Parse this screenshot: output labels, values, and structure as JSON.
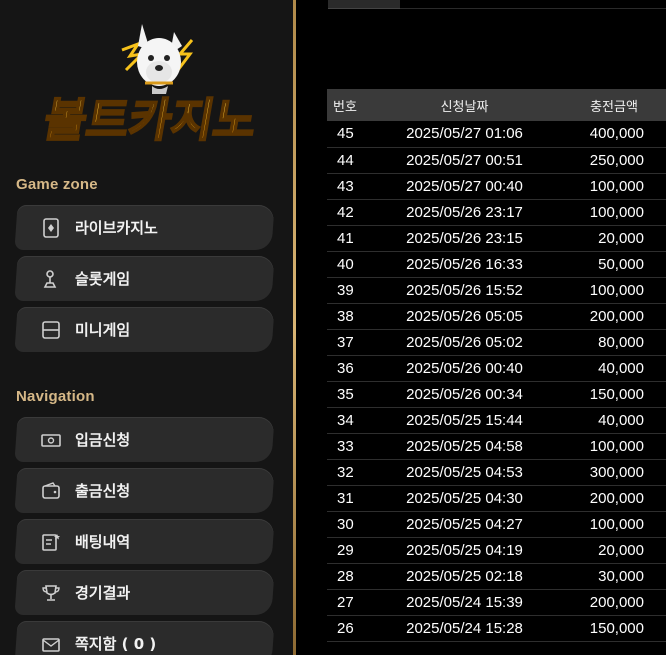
{
  "brand": {
    "logo_text": "볼트카지노",
    "colors": {
      "gold": "#f7b21b",
      "gold_dark": "#c47a0b",
      "accent": "#d6b887"
    }
  },
  "sidebar": {
    "game_zone_title": "Game zone",
    "game_zone_items": [
      {
        "label": "라이브카지노",
        "icon": "card-icon"
      },
      {
        "label": "슬롯게임",
        "icon": "joystick-icon"
      },
      {
        "label": "미니게임",
        "icon": "window-icon"
      }
    ],
    "navigation_title": "Navigation",
    "navigation_items": [
      {
        "label": "입금신청",
        "icon": "cash-icon"
      },
      {
        "label": "출금신청",
        "icon": "wallet-icon"
      },
      {
        "label": "배팅내역",
        "icon": "note-icon"
      },
      {
        "label": "경기결과",
        "icon": "trophy-icon"
      },
      {
        "label": "쪽지함 ( 0 )",
        "icon": "mail-icon"
      }
    ]
  },
  "history_table": {
    "headers": [
      "번호",
      "신청날짜",
      "충전금액"
    ],
    "rows": [
      {
        "no": "45",
        "date": "2025/05/27 01:06",
        "amount": "400,000"
      },
      {
        "no": "44",
        "date": "2025/05/27 00:51",
        "amount": "250,000"
      },
      {
        "no": "43",
        "date": "2025/05/27 00:40",
        "amount": "100,000"
      },
      {
        "no": "42",
        "date": "2025/05/26 23:17",
        "amount": "100,000"
      },
      {
        "no": "41",
        "date": "2025/05/26 23:15",
        "amount": "20,000"
      },
      {
        "no": "40",
        "date": "2025/05/26 16:33",
        "amount": "50,000"
      },
      {
        "no": "39",
        "date": "2025/05/26 15:52",
        "amount": "100,000"
      },
      {
        "no": "38",
        "date": "2025/05/26 05:05",
        "amount": "200,000"
      },
      {
        "no": "37",
        "date": "2025/05/26 05:02",
        "amount": "80,000"
      },
      {
        "no": "36",
        "date": "2025/05/26 00:40",
        "amount": "40,000"
      },
      {
        "no": "35",
        "date": "2025/05/26 00:34",
        "amount": "150,000"
      },
      {
        "no": "34",
        "date": "2025/05/25 15:44",
        "amount": "40,000"
      },
      {
        "no": "33",
        "date": "2025/05/25 04:58",
        "amount": "100,000"
      },
      {
        "no": "32",
        "date": "2025/05/25 04:53",
        "amount": "300,000"
      },
      {
        "no": "31",
        "date": "2025/05/25 04:30",
        "amount": "200,000"
      },
      {
        "no": "30",
        "date": "2025/05/25 04:27",
        "amount": "100,000"
      },
      {
        "no": "29",
        "date": "2025/05/25 04:19",
        "amount": "20,000"
      },
      {
        "no": "28",
        "date": "2025/05/25 02:18",
        "amount": "30,000"
      },
      {
        "no": "27",
        "date": "2025/05/24 15:39",
        "amount": "200,000"
      },
      {
        "no": "26",
        "date": "2025/05/24 15:28",
        "amount": "150,000"
      }
    ]
  }
}
